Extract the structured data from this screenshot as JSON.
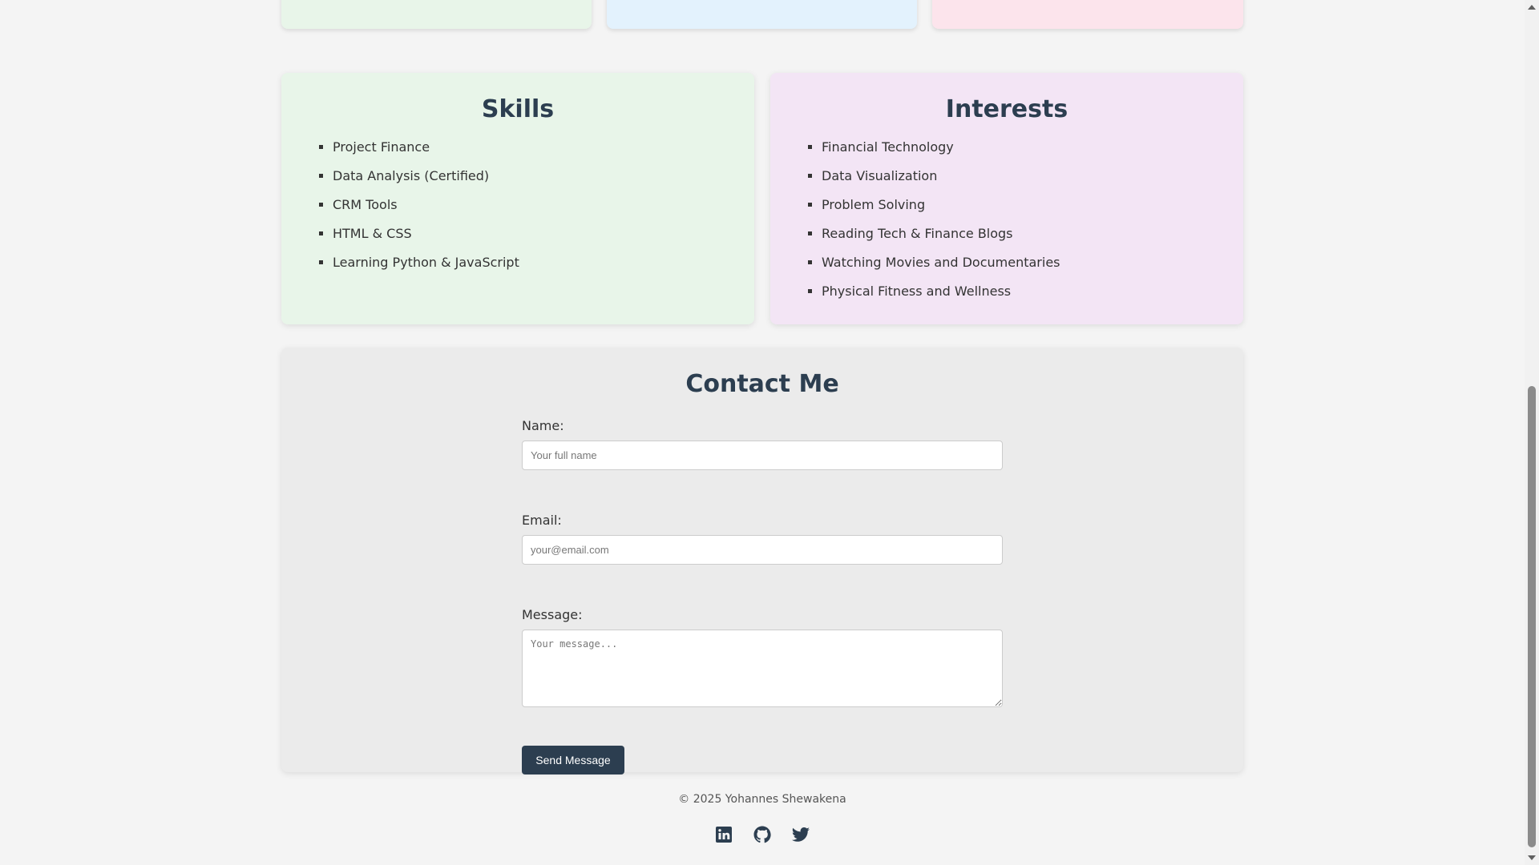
{
  "colors": {
    "top_card_1": "#e8f5e9",
    "top_card_2": "#e3f2fd",
    "top_card_3": "#fce4ec",
    "skills_bg": "#e8f5e9",
    "interests_bg": "#f3e5f5",
    "contact_bg": "#ebebeb",
    "heading": "#2c3e50",
    "button": "#2c3e50"
  },
  "skills": {
    "title": "Skills",
    "items": [
      "Project Finance",
      "Data Analysis (Certified)",
      "CRM Tools",
      "HTML & CSS",
      "Learning Python & JavaScript"
    ]
  },
  "interests": {
    "title": "Interests",
    "items": [
      "Financial Technology",
      "Data Visualization",
      "Problem Solving",
      "Reading Tech & Finance Blogs",
      "Watching Movies and Documentaries",
      "Physical Fitness and Wellness"
    ]
  },
  "contact": {
    "title": "Contact Me",
    "name_label": "Name:",
    "name_placeholder": "Your full name",
    "email_label": "Email:",
    "email_placeholder": "your@email.com",
    "message_label": "Message:",
    "message_placeholder": "Your message...",
    "submit_label": "Send Message"
  },
  "footer": {
    "copyright": "© 2025 Yohannes Shewakena",
    "social_icons": [
      "linkedin-icon",
      "github-icon",
      "twitter-icon"
    ]
  }
}
